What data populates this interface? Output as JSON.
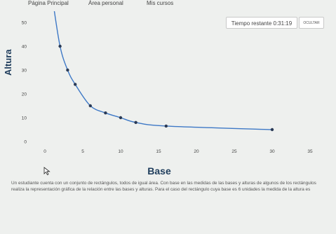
{
  "nav": {
    "items": [
      "Página Principal",
      "Área personal",
      "Mis cursos"
    ]
  },
  "timer": {
    "label": "Tiempo restante 0:31:19",
    "hide_button": "OCULTAR"
  },
  "chart_data": {
    "type": "line",
    "xlabel": "Base",
    "ylabel": "Altura",
    "xlim": [
      0,
      35
    ],
    "ylim": [
      0,
      50
    ],
    "x_ticks": [
      0,
      5,
      10,
      15,
      20,
      25,
      30,
      35
    ],
    "y_ticks": [
      0,
      10,
      20,
      30,
      40,
      50
    ],
    "grid": false,
    "series": [
      {
        "color": "#3d78c6",
        "x": [
          1,
          2,
          3,
          4,
          6,
          8,
          10,
          12,
          16,
          30
        ],
        "y": [
          60,
          40,
          30,
          24,
          15,
          12,
          10,
          8,
          6.5,
          5
        ]
      }
    ]
  },
  "problem": {
    "text": "Un estudiante cuenta con un conjunto de rectángulos, todos de igual área. Con base en las medidas de las bases y alturas de algunos de los rectángulos realiza la representación gráfica de la relación entre las bases y alturas. Para el caso del rectángulo cuya base es 6 unidades la medida de la altura es"
  }
}
